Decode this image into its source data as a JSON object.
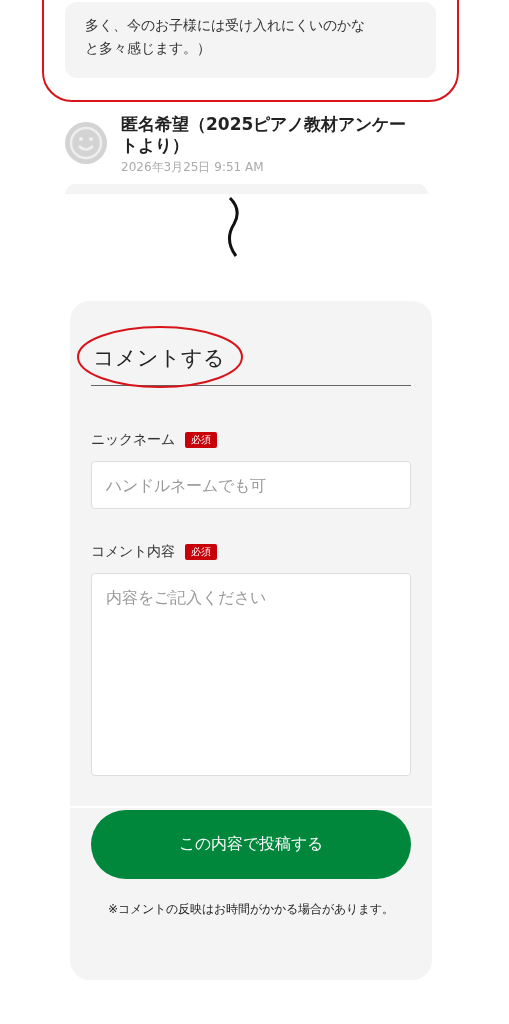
{
  "highlighted_comment": {
    "text": "多く、今のお子様には受け入れにくいのかなと多々感じます。）"
  },
  "comment": {
    "author": "匿名希望（2025ピアノ教材アンケートより）",
    "date": "2026年3月25日 9:51 AM"
  },
  "comment_form": {
    "title": "コメントする",
    "fields": [
      {
        "kind": "input",
        "label": "ニックネーム",
        "badge": "必須",
        "placeholder": "ハンドルネームでも可"
      },
      {
        "kind": "textarea",
        "label": "コメント内容",
        "badge": "必須",
        "placeholder": "内容をご記入ください"
      }
    ],
    "submit_button": "この内容で投稿する",
    "note": "※コメントの反映はお時間がかかる場合があります。"
  }
}
